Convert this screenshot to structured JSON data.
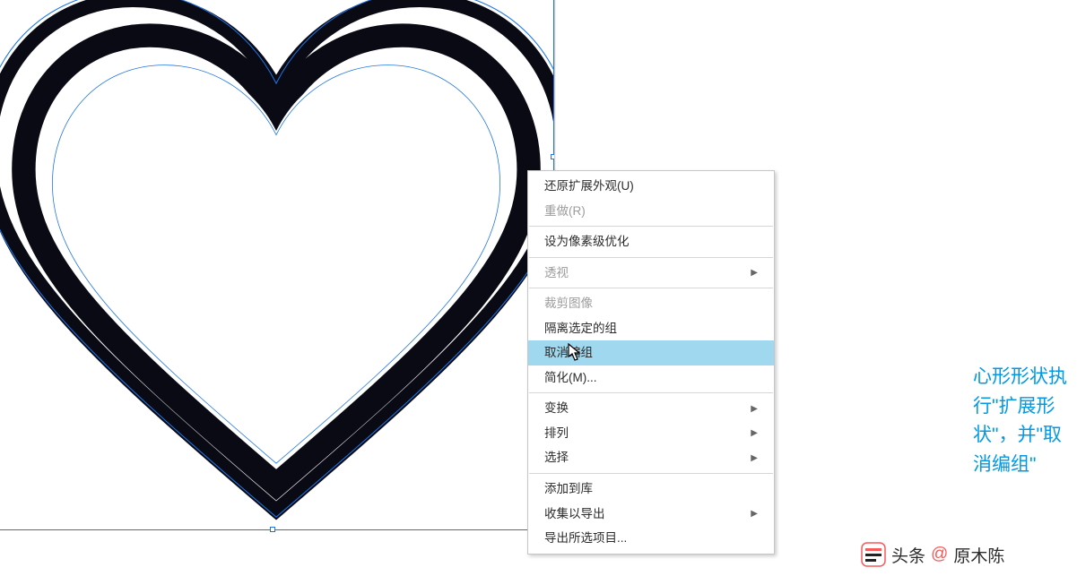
{
  "menu": {
    "items": [
      {
        "label": "还原扩展外观(U)",
        "disabled": false,
        "submenu": false
      },
      {
        "label": "重做(R)",
        "disabled": true,
        "submenu": false
      },
      {
        "sep": true
      },
      {
        "label": "设为像素级优化",
        "disabled": false,
        "submenu": false
      },
      {
        "sep": true
      },
      {
        "label": "透视",
        "disabled": true,
        "submenu": true
      },
      {
        "sep": true
      },
      {
        "label": "裁剪图像",
        "disabled": true,
        "submenu": false
      },
      {
        "label": "隔离选定的组",
        "disabled": false,
        "submenu": false
      },
      {
        "label": "取消编组",
        "disabled": false,
        "submenu": false,
        "highlighted": true
      },
      {
        "label": "简化(M)...",
        "disabled": false,
        "submenu": false
      },
      {
        "sep": true
      },
      {
        "label": "变换",
        "disabled": false,
        "submenu": true
      },
      {
        "label": "排列",
        "disabled": false,
        "submenu": true
      },
      {
        "label": "选择",
        "disabled": false,
        "submenu": true
      },
      {
        "sep": true
      },
      {
        "label": "添加到库",
        "disabled": false,
        "submenu": false
      },
      {
        "label": "收集以导出",
        "disabled": false,
        "submenu": true
      },
      {
        "label": "导出所选项目...",
        "disabled": false,
        "submenu": false
      }
    ]
  },
  "caption": "心形形状执行\"扩展形状\"，并\"取消编组\"",
  "watermark": {
    "brand": "头条",
    "at": "@",
    "author": "原木陈"
  },
  "colors": {
    "highlight": "#a0d8ef",
    "caption": "#0099e5",
    "selection": "#1e74e7"
  }
}
